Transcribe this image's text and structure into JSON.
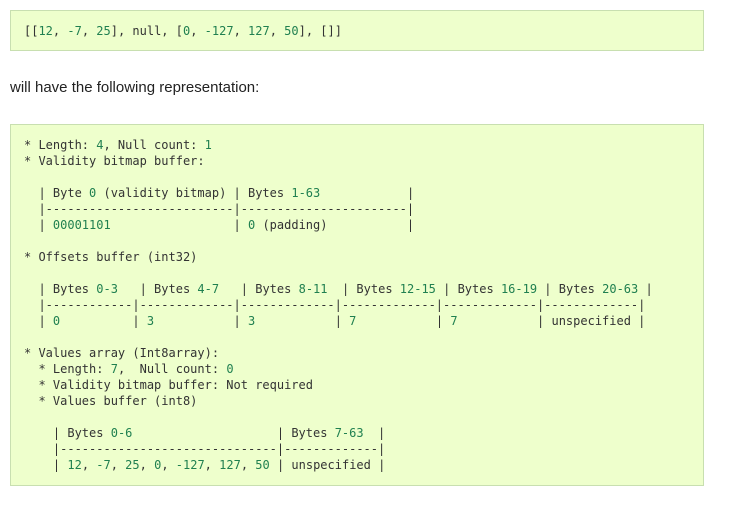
{
  "example_code": "[[12, -7, 25], null, [0, -127, 127, 50], []]",
  "intro_text": "will have the following representation:",
  "representation": "* Length: 4, Null count: 1\n* Validity bitmap buffer:\n\n  | Byte 0 (validity bitmap) | Bytes 1-63            |\n  |--------------------------|-----------------------|\n  | 00001101                 | 0 (padding)           |\n\n* Offsets buffer (int32)\n\n  | Bytes 0-3   | Bytes 4-7   | Bytes 8-11  | Bytes 12-15 | Bytes 16-19 | Bytes 20-63 |\n  |------------|-------------|-------------|-------------|-------------|-------------|\n  | 0          | 3           | 3           | 7           | 7           | unspecified |\n\n* Values array (Int8array):\n  * Length: 7,  Null count: 0\n  * Validity bitmap buffer: Not required\n  * Values buffer (int8)\n\n    | Bytes 0-6                    | Bytes 7-63  |\n    |------------------------------|-------------|\n    | 12, -7, 25, 0, -127, 127, 50 | unspecified |"
}
